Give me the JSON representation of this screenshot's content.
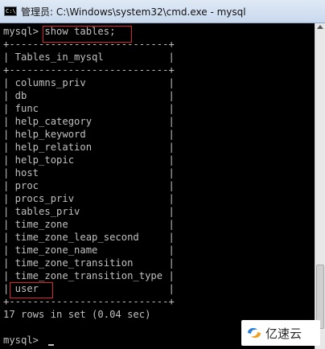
{
  "window": {
    "title": "管理员: C:\\Windows\\system32\\cmd.exe - mysql",
    "icon": "cmd-icon"
  },
  "console": {
    "lines": [
      "mysql> show tables;",
      "+---------------------------+",
      "| Tables_in_mysql           |",
      "+---------------------------+",
      "| columns_priv              |",
      "| db                        |",
      "| func                      |",
      "| help_category             |",
      "| help_keyword              |",
      "| help_relation             |",
      "| help_topic                |",
      "| host                      |",
      "| proc                      |",
      "| procs_priv                |",
      "| tables_priv               |",
      "| time_zone                 |",
      "| time_zone_leap_second     |",
      "| time_zone_name            |",
      "| time_zone_transition      |",
      "| time_zone_transition_type |",
      "| user                      |",
      "+---------------------------+",
      "17 rows in set (0.04 sec)",
      "",
      "mysql> "
    ]
  },
  "watermark": {
    "text": "亿速云"
  },
  "colors": {
    "console_bg": "#000000",
    "console_text": "#c0c0c0",
    "highlight_box": "#d42828"
  }
}
